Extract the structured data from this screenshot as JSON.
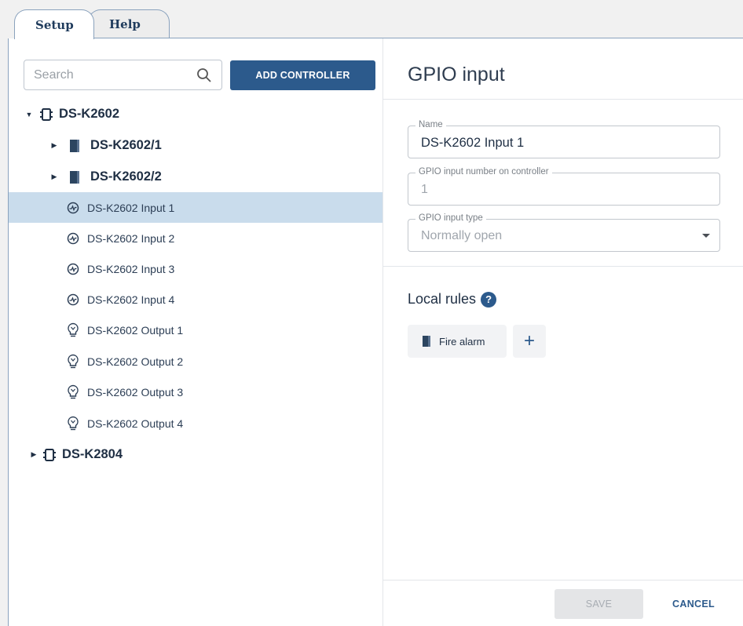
{
  "tabs": [
    {
      "label": "Setup",
      "active": true
    },
    {
      "label": "Help",
      "active": false
    }
  ],
  "search": {
    "placeholder": "Search"
  },
  "add_controller_label": "ADD CONTROLLER",
  "tree": [
    {
      "label": "DS-K2602",
      "type": "controller",
      "expanded": true
    },
    {
      "label": "DS-K2602/1",
      "type": "door"
    },
    {
      "label": "DS-K2602/2",
      "type": "door"
    },
    {
      "label": "DS-K2602 Input 1",
      "type": "input",
      "selected": true
    },
    {
      "label": "DS-K2602 Input 2",
      "type": "input"
    },
    {
      "label": "DS-K2602 Input 3",
      "type": "input"
    },
    {
      "label": "DS-K2602 Input 4",
      "type": "input"
    },
    {
      "label": "DS-K2602 Output 1",
      "type": "output"
    },
    {
      "label": "DS-K2602 Output 2",
      "type": "output"
    },
    {
      "label": "DS-K2602 Output 3",
      "type": "output"
    },
    {
      "label": "DS-K2602 Output 4",
      "type": "output"
    },
    {
      "label": "DS-K2804",
      "type": "controller",
      "expanded": false
    }
  ],
  "panel": {
    "title": "GPIO input",
    "name_label": "Name",
    "name_value": "DS-K2602 Input 1",
    "number_label": "GPIO input number on controller",
    "number_value": "1",
    "type_label": "GPIO input type",
    "type_value": "Normally open",
    "local_rules_label": "Local rules",
    "help_glyph": "?",
    "rule_chip": "Fire alarm",
    "add_glyph": "+",
    "save_label": "SAVE",
    "cancel_label": "CANCEL"
  },
  "colors": {
    "accent": "#2c5a8c",
    "selection": "#c9dcec",
    "text": "#1f2f44"
  }
}
